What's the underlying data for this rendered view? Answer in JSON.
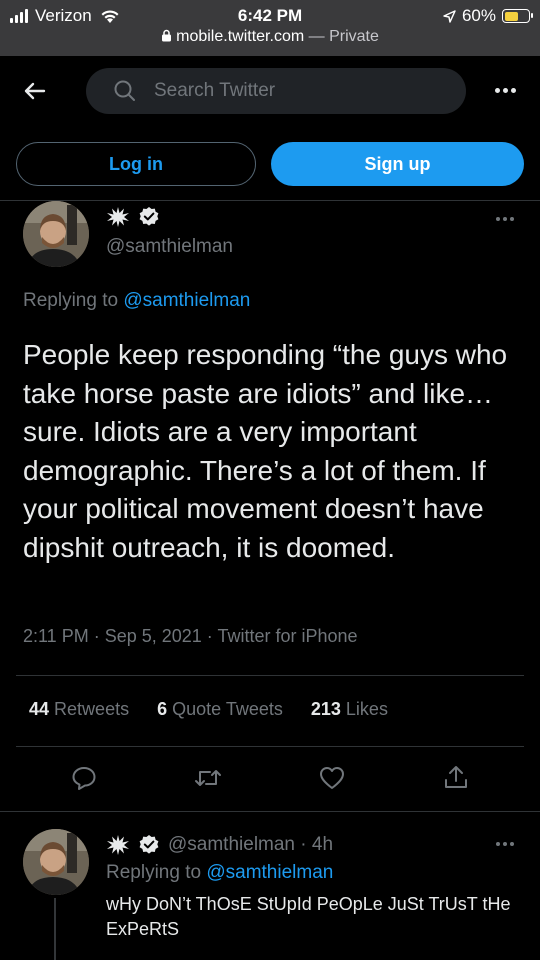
{
  "status_bar": {
    "carrier": "Verizon",
    "time": "6:42 PM",
    "battery": "60%",
    "battery_level": 0.6,
    "url": "mobile.twitter.com",
    "url_suffix": "— Private"
  },
  "header": {
    "search_placeholder": "Search Twitter"
  },
  "auth": {
    "login_label": "Log in",
    "signup_label": "Sign up"
  },
  "tweet": {
    "handle": "@samthielman",
    "replying_prefix": "Replying to ",
    "replying_handle": "@samthielman",
    "text": "People keep responding “the guys who take horse paste are idiots” and like… sure. Idiots are a very important demographic. There’s a lot of them. If your political movement doesn’t have dipshit outreach, it is doomed.",
    "timestamp": "2:11 PM · Sep 5, 2021 · Twitter for iPhone",
    "retweets_count": "44",
    "retweets_label": "Retweets",
    "quotes_count": "6",
    "quotes_label": "Quote Tweets",
    "likes_count": "213",
    "likes_label": "Likes"
  },
  "reply": {
    "handle_time": "@samthielman · 4h",
    "replying_prefix": "Replying to ",
    "replying_handle": "@samthielman",
    "text": "wHy DoN’t ThOsE StUpId PeOpLe JuSt TrUsT tHe ExPeRtS"
  },
  "colors": {
    "accent": "#1d9bf0",
    "background": "#000000",
    "muted": "#71767b",
    "battery": "#f4d03f"
  },
  "icons": [
    "back-arrow-icon",
    "search-icon",
    "more-icon",
    "verified-icon",
    "burst-icon",
    "reply-icon",
    "retweet-icon",
    "like-icon",
    "share-icon",
    "lock-icon",
    "wifi-icon",
    "location-arrow-icon"
  ]
}
